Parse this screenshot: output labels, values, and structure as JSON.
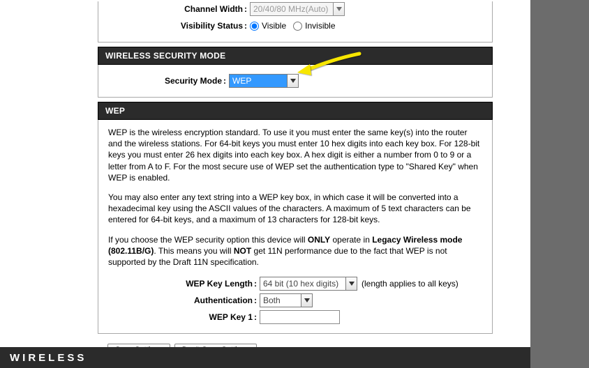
{
  "top": {
    "channel_width_label": "Channel Width",
    "channel_width_value": "20/40/80 MHz(Auto)",
    "visibility_label": "Visibility Status",
    "visibility_visible": "Visible",
    "visibility_invisible": "Invisible"
  },
  "security_mode_section": {
    "header": "WIRELESS SECURITY MODE",
    "label": "Security Mode",
    "value": "WEP"
  },
  "wep_section": {
    "header": "WEP",
    "p1": "WEP is the wireless encryption standard. To use it you must enter the same key(s) into the router and the wireless stations. For 64-bit keys you must enter 10 hex digits into each key box. For 128-bit keys you must enter 26 hex digits into each key box. A hex digit is either a number from 0 to 9 or a letter from A to F. For the most secure use of WEP set the authentication type to \"Shared Key\" when WEP is enabled.",
    "p2": "You may also enter any text string into a WEP key box, in which case it will be converted into a hexadecimal key using the ASCII values of the characters. A maximum of 5 text characters can be entered for 64-bit keys, and a maximum of 13 characters for 128-bit keys.",
    "p3a": "If you choose the WEP security option this device will ",
    "p3_only": "ONLY",
    "p3b": " operate in ",
    "p3_legacy": "Legacy Wireless mode (802.11B/G)",
    "p3c": ". This means you will ",
    "p3_not": "NOT",
    "p3d": " get 11N performance due to the fact that WEP is not supported by the Draft 11N specification.",
    "key_length_label": "WEP Key Length",
    "key_length_value": "64 bit (10 hex digits)",
    "key_length_hint": "(length applies to all keys)",
    "auth_label": "Authentication",
    "auth_value": "Both",
    "key1_label": "WEP Key 1"
  },
  "buttons": {
    "save": "Save Settings",
    "dont_save": "Don't Save Settings"
  },
  "footer": "WIRELESS"
}
